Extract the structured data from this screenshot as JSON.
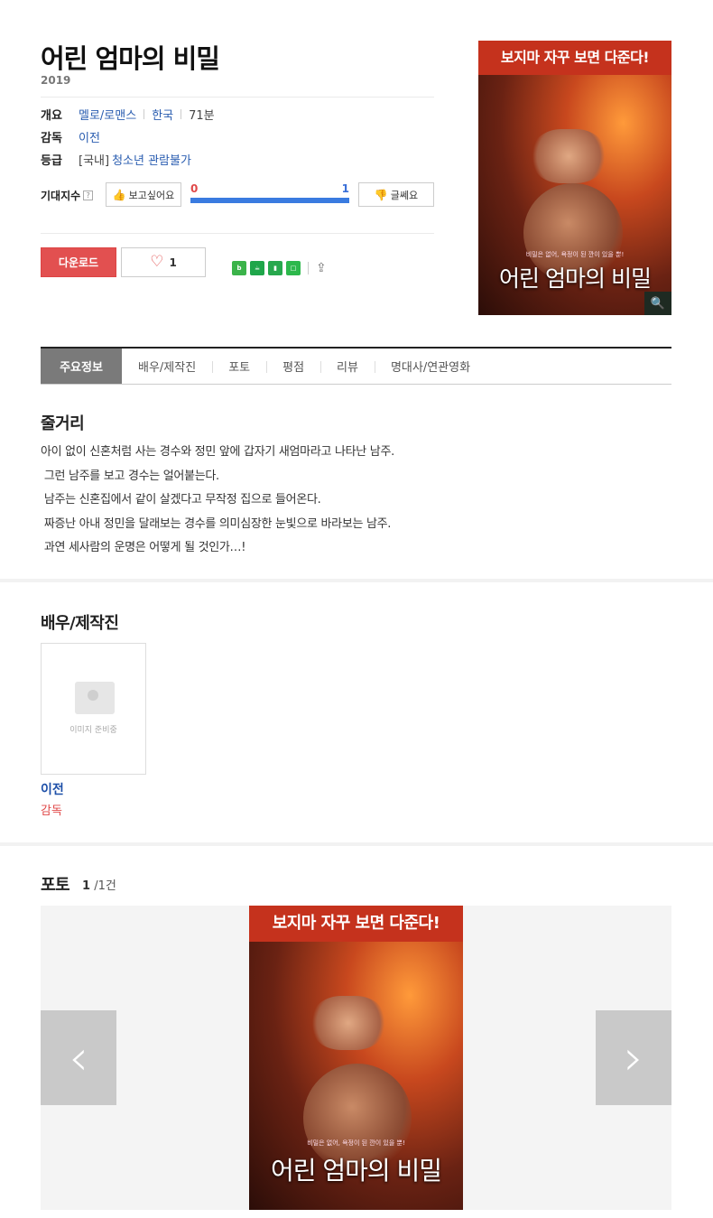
{
  "movie": {
    "title": "어린 엄마의 비밀",
    "year": "2019",
    "info": {
      "overview_label": "개요",
      "genre": "멜로/로맨스",
      "country": "한국",
      "runtime": "71분",
      "director_label": "감독",
      "director": "이전",
      "rating_label": "등급",
      "rating_prefix": "[국내]",
      "rating": "청소년 관람불가"
    },
    "expectation": {
      "label": "기대지수",
      "help_icon": "?",
      "want_label": "보고싶어요",
      "dislike_label": "글쎄요",
      "want_count": "0",
      "dislike_count": "1"
    },
    "actions": {
      "download_label": "다운로드",
      "like_count": "1"
    },
    "share_icons": [
      "band-icon",
      "cafe-icon",
      "bookmark-icon",
      "memo-icon",
      "share-icon"
    ],
    "poster": {
      "tagline": "보지마 자꾸 보면 다준다!",
      "subtitle": "비밀은 없어, 욕정이 된 깐이 있을 뿐!",
      "name": "어린 엄마의 비밀"
    }
  },
  "tabs": [
    {
      "label": "주요정보"
    },
    {
      "label": "배우/제작진"
    },
    {
      "label": "포토"
    },
    {
      "label": "평점"
    },
    {
      "label": "리뷰"
    },
    {
      "label": "명대사/연관영화"
    }
  ],
  "synopsis": {
    "title": "줄거리",
    "text": "아이 없이 신혼처럼 사는 경수와 정민 앞에 갑자기 새엄마라고 나타난 남주.\n 그런 남주를 보고 경수는 얼어붙는다.\n 남주는 신혼집에서 같이 살겠다고 무작정 집으로 들어온다.\n 짜증난 아내 정민을 달래보는 경수를 의미심장한 눈빛으로 바라보는 남주.\n 과연 세사람의 운명은 어떻게 될 것인가…!"
  },
  "cast": {
    "title": "배우/제작진",
    "placeholder_text": "이미지 준비중",
    "members": [
      {
        "name": "이전",
        "role": "감독"
      }
    ]
  },
  "photo": {
    "title": "포토",
    "current": "1",
    "total": "/1건",
    "prev_label": "‹",
    "next_label": "›"
  },
  "colors": {
    "accent_red": "#e25050",
    "link_blue": "#2a5db0",
    "tab_active": "#7a7a7a"
  }
}
